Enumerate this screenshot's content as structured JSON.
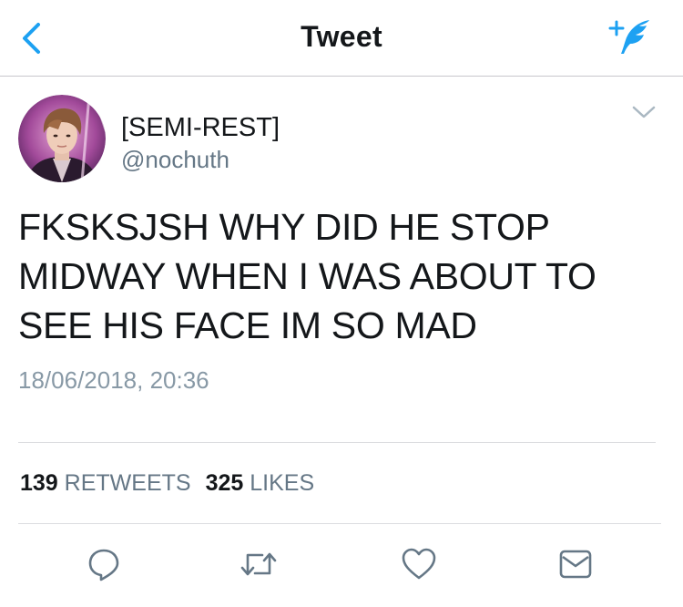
{
  "nav": {
    "title": "Tweet",
    "back_icon": "chevron-left-icon",
    "compose_icon": "compose-feather-icon"
  },
  "colors": {
    "accent": "#1da1f2",
    "text": "#14171a",
    "secondary_text": "#657786",
    "timestamp": "#8899a6",
    "action_icon": "#657786"
  },
  "tweet": {
    "author": {
      "display_name": "[SEMI-REST]",
      "handle": "@nochuth"
    },
    "text": "FKSKSJSH WHY DID HE STOP\nMIDWAY WHEN I WAS ABOUT TO\nSEE HIS FACE IM SO MAD",
    "timestamp": "18/06/2018, 20:36",
    "stats": {
      "retweets_count": "139",
      "retweets_label": "RETWEETS",
      "likes_count": "325",
      "likes_label": "LIKES"
    }
  },
  "actions": [
    {
      "name": "reply",
      "icon": "reply-bubble-icon"
    },
    {
      "name": "retweet",
      "icon": "retweet-icon"
    },
    {
      "name": "like",
      "icon": "heart-icon"
    },
    {
      "name": "direct-message",
      "icon": "envelope-icon"
    }
  ]
}
